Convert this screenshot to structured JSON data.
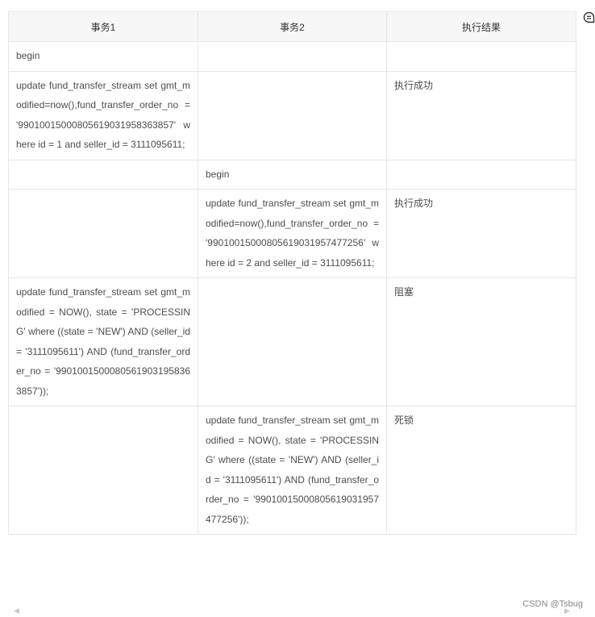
{
  "table": {
    "headers": [
      "事务1",
      "事务2",
      "执行结果"
    ],
    "rows": [
      [
        "begin",
        "",
        ""
      ],
      [
        "update fund_transfer_stream set gmt_modified=now(),fund_transfer_order_no = '99010015000805619031958363857' where id = 1 and seller_id = 3111095611;",
        "",
        "执行成功"
      ],
      [
        "",
        "begin",
        ""
      ],
      [
        "",
        "update fund_transfer_stream set gmt_modified=now(),fund_transfer_order_no = '99010015000805619031957477256' where id = 2 and seller_id = 3111095611;",
        "执行成功"
      ],
      [
        "update fund_transfer_stream set gmt_modified = NOW(), state = 'PROCESSING' where ((state = 'NEW') AND (seller_id = '3111095611') AND (fund_transfer_order_no = '99010015000805619031958363857'));",
        "",
        "阻塞"
      ],
      [
        "",
        "update fund_transfer_stream set gmt_modified = NOW(), state = 'PROCESSING' where ((state = 'NEW') AND (seller_id = '3111095611') AND (fund_transfer_order_no = '99010015000805619031957477256'));",
        "死锁"
      ]
    ]
  },
  "credit": "CSDN @Tsbug",
  "icons": {
    "comment": "comment-icon",
    "scroll_left": "scroll-left-icon",
    "scroll_right": "scroll-right-icon"
  }
}
